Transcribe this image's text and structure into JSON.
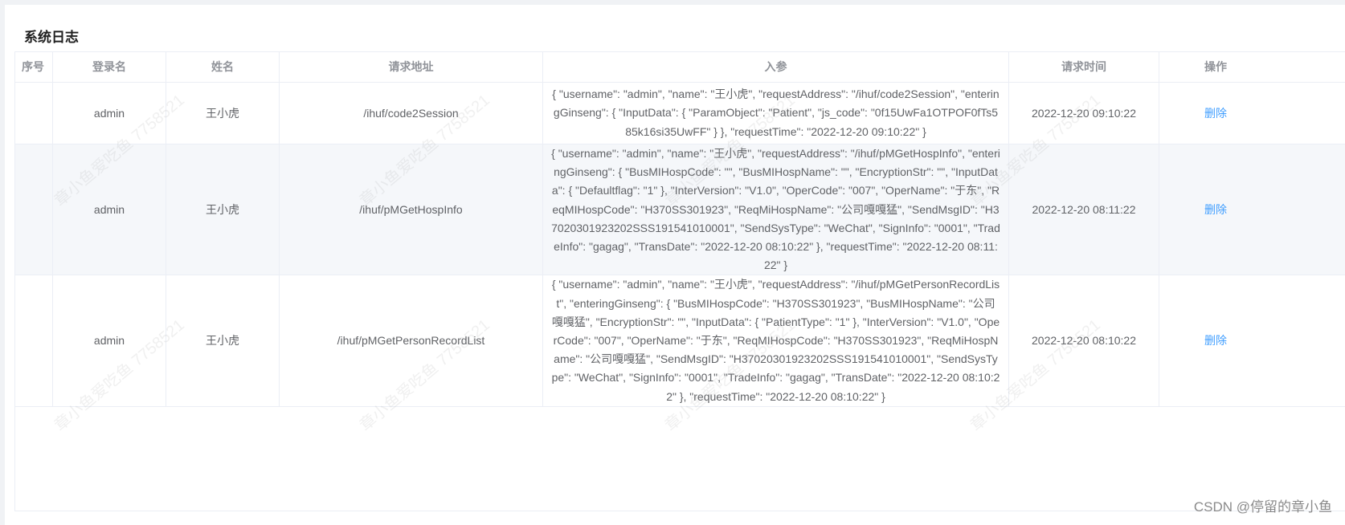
{
  "page": {
    "title": "系统日志",
    "watermark_text": "章小鱼爱吃鱼 7758521",
    "credit": "CSDN @停留的章小鱼"
  },
  "table": {
    "headers": {
      "index": "序号",
      "login_name": "登录名",
      "name": "姓名",
      "address": "请求地址",
      "params": "入参",
      "time": "请求时间",
      "action": "操作"
    },
    "rows": [
      {
        "index": "",
        "login_name": "admin",
        "name": "王小虎",
        "address": "/ihuf/code2Session",
        "params": "{ \"username\": \"admin\", \"name\": \"王小虎\", \"requestAddress\": \"/ihuf/code2Session\", \"enteringGinseng\": { \"InputData\": { \"ParamObject\": \"Patient\", \"js_code\": \"0f15UwFa1OTPOF0fTs585k16si35UwFF\" } }, \"requestTime\": \"2022-12-20 09:10:22\" }",
        "time": "2022-12-20 09:10:22",
        "action": "删除"
      },
      {
        "index": "",
        "login_name": "admin",
        "name": "王小虎",
        "address": "/ihuf/pMGetHospInfo",
        "params": "{ \"username\": \"admin\", \"name\": \"王小虎\", \"requestAddress\": \"/ihuf/pMGetHospInfo\", \"enteringGinseng\": { \"BusMIHospCode\": \"\", \"BusMIHospName\": \"\", \"EncryptionStr\": \"\", \"InputData\": { \"Defaultflag\": \"1\" }, \"InterVersion\": \"V1.0\", \"OperCode\": \"007\", \"OperName\": \"于东\", \"ReqMIHospCode\": \"H370SS301923\", \"ReqMiHospName\": \"公司嘎嘎猛\", \"SendMsgID\": \"H37020301923202SSS191541010001\", \"SendSysType\": \"WeChat\", \"SignInfo\": \"0001\", \"TradeInfo\": \"gagag\", \"TransDate\": \"2022-12-20 08:10:22\" }, \"requestTime\": \"2022-12-20 08:11:22\" }",
        "time": "2022-12-20 08:11:22",
        "action": "删除"
      },
      {
        "index": "",
        "login_name": "admin",
        "name": "王小虎",
        "address": "/ihuf/pMGetPersonRecordList",
        "params": "{ \"username\": \"admin\", \"name\": \"王小虎\", \"requestAddress\": \"/ihuf/pMGetPersonRecordList\", \"enteringGinseng\": { \"BusMIHospCode\": \"H370SS301923\", \"BusMIHospName\": \"公司嘎嘎猛\", \"EncryptionStr\": \"\", \"InputData\": { \"PatientType\": \"1\" }, \"InterVersion\": \"V1.0\", \"OperCode\": \"007\", \"OperName\": \"于东\", \"ReqMIHospCode\": \"H370SS301923\", \"ReqMiHospName\": \"公司嘎嘎猛\", \"SendMsgID\": \"H37020301923202SSS191541010001\", \"SendSysType\": \"WeChat\", \"SignInfo\": \"0001\", \"TradeInfo\": \"gagag\", \"TransDate\": \"2022-12-20 08:10:22\" }, \"requestTime\": \"2022-12-20 08:10:22\" }",
        "time": "2022-12-20 08:10:22",
        "action": "删除"
      }
    ]
  }
}
